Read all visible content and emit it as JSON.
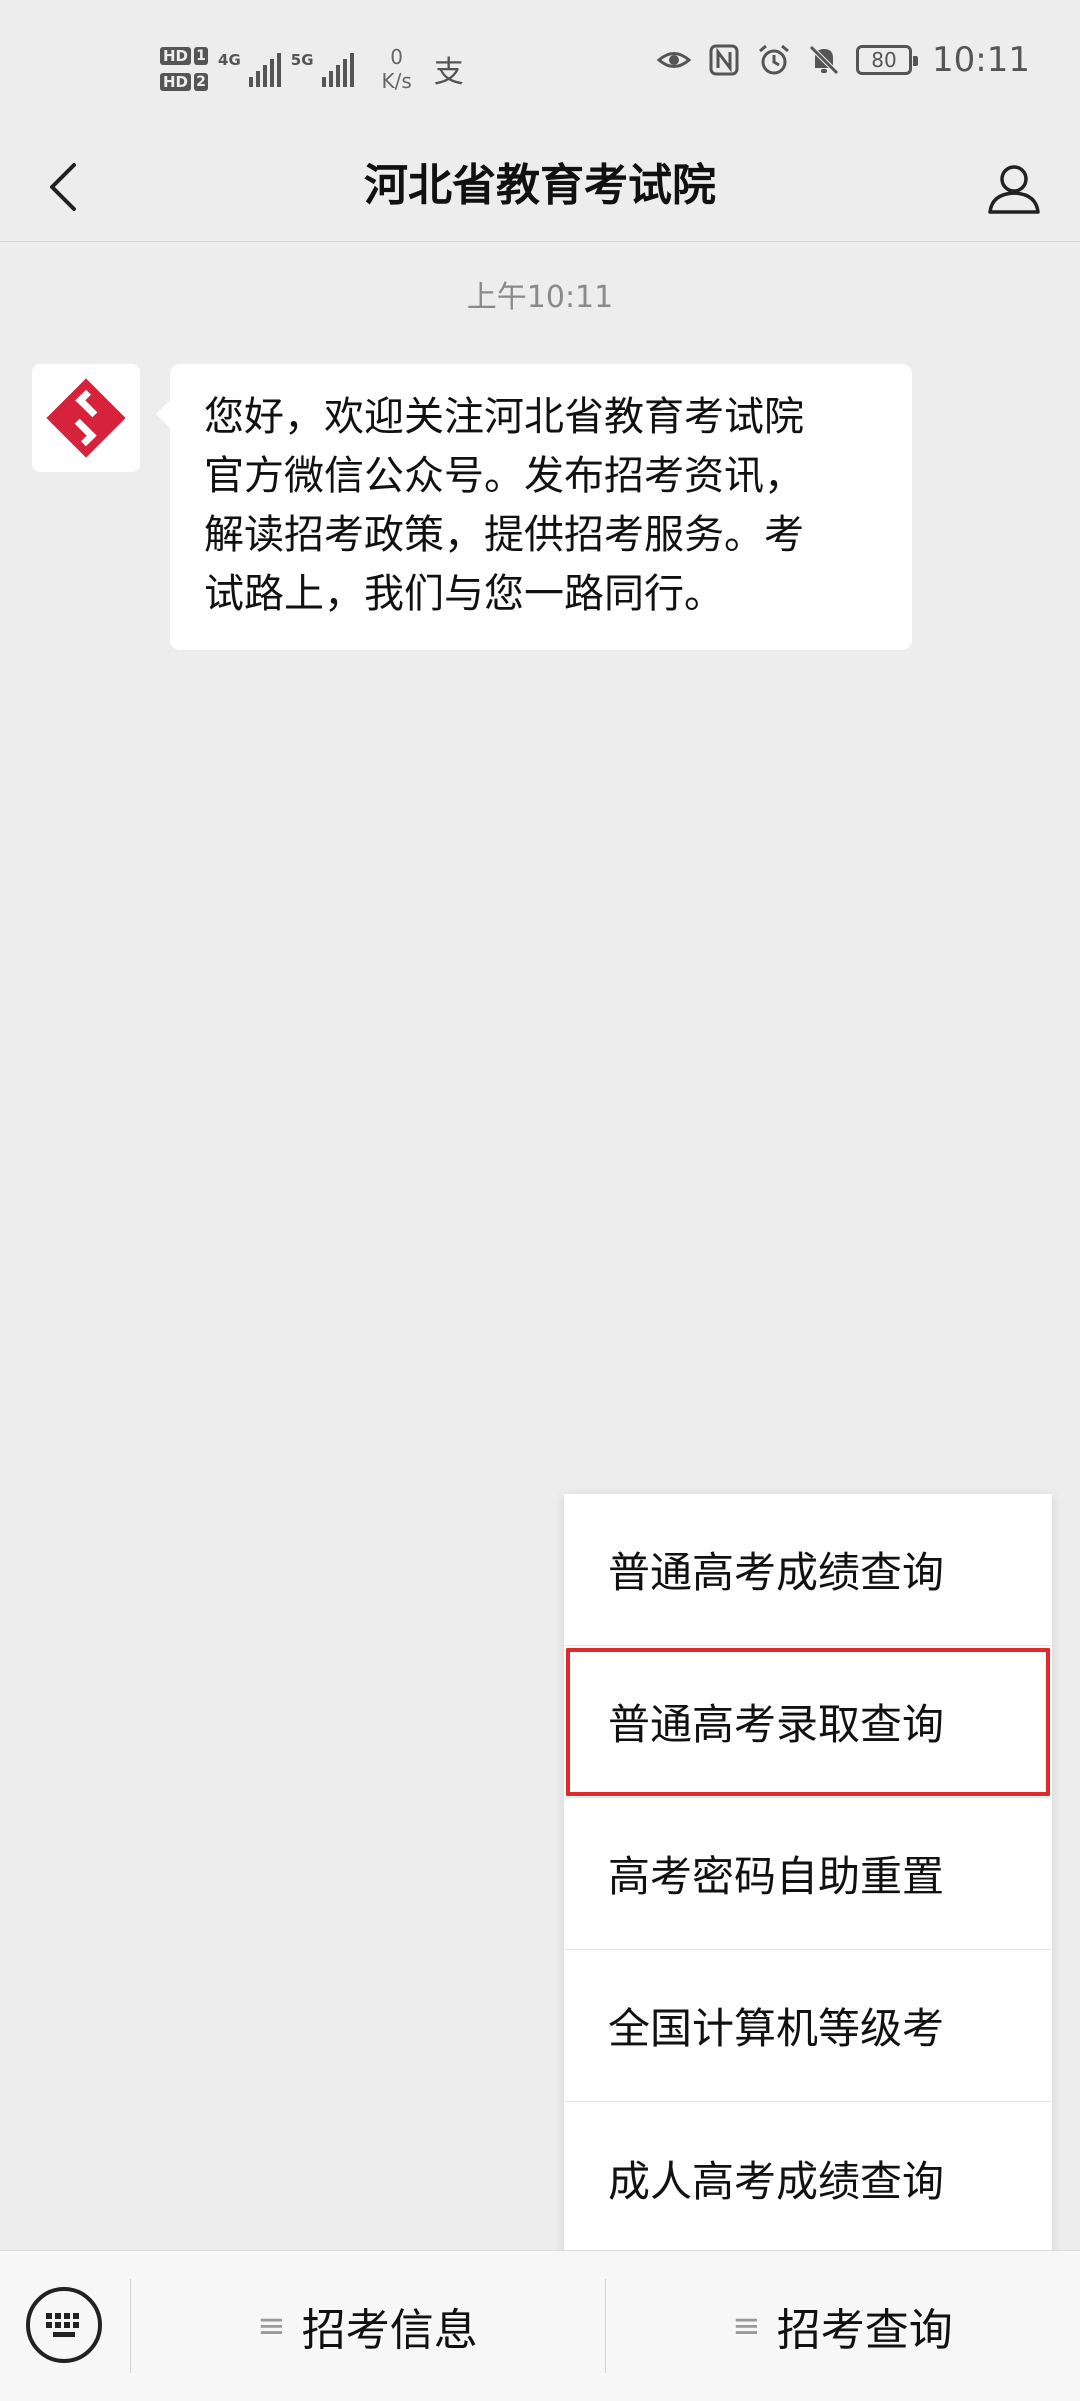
{
  "status_bar": {
    "hd1": "HD",
    "sim1": "1",
    "hd2": "HD",
    "sim2": "2",
    "net1": "4G",
    "net2": "5G",
    "speed_value": "0",
    "speed_unit": "K/s",
    "extra_glyph": "支",
    "battery_level": "80",
    "time": "10:11",
    "icons": [
      "eye-icon",
      "nfc-icon",
      "alarm-icon",
      "mute-bell-icon",
      "battery-icon"
    ]
  },
  "nav": {
    "title": "河北省教育考试院",
    "back_icon": "back-chevron-icon",
    "profile_icon": "profile-icon"
  },
  "chat": {
    "timestamp": "上午10:11",
    "message_lines": [
      "您好，欢迎关注河北省教育考试院",
      "官方微信公众号。发布招考资讯，",
      "解读招考政策，提供招考服务。考",
      "试路上，我们与您一路同行。"
    ]
  },
  "popup_menu": {
    "items": [
      {
        "label": "普通高考成绩查询",
        "highlighted": false
      },
      {
        "label": "普通高考录取查询",
        "highlighted": true
      },
      {
        "label": "高考密码自助重置",
        "highlighted": false
      },
      {
        "label": "全国计算机等级考",
        "highlighted": false
      },
      {
        "label": "成人高考成绩查询",
        "highlighted": false
      }
    ],
    "highlight_color": "#e02a2a"
  },
  "bottom_bar": {
    "keyboard_icon": "keyboard-icon",
    "tabs": [
      {
        "label": "招考信息",
        "icon": "≡"
      },
      {
        "label": "招考查询",
        "icon": "≡"
      }
    ]
  },
  "colors": {
    "background": "#ededed",
    "logo_red": "#d6223a"
  }
}
